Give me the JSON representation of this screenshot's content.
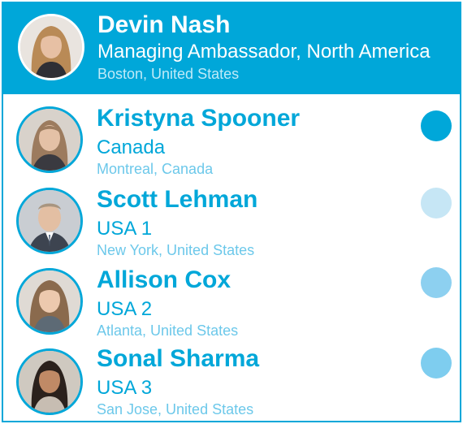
{
  "header": {
    "name": "Devin Nash",
    "role": "Managing Ambassador, North America",
    "location": "Boston, United States"
  },
  "members": [
    {
      "name": "Kristyna Spooner",
      "role": "Canada",
      "location": "Montreal, Canada",
      "status_color": "#00a7d9"
    },
    {
      "name": "Scott Lehman",
      "role": "USA 1",
      "location": "New York, United States",
      "status_color": "#c6e6f5"
    },
    {
      "name": "Allison Cox",
      "role": "USA 2",
      "location": "Atlanta, United States",
      "status_color": "#8dd0f0"
    },
    {
      "name": "Sonal Sharma",
      "role": "USA 3",
      "location": "San Jose, United States",
      "status_color": "#7ecdef"
    }
  ],
  "colors": {
    "accent": "#00a7d9",
    "location_text": "#6cc8ea"
  }
}
